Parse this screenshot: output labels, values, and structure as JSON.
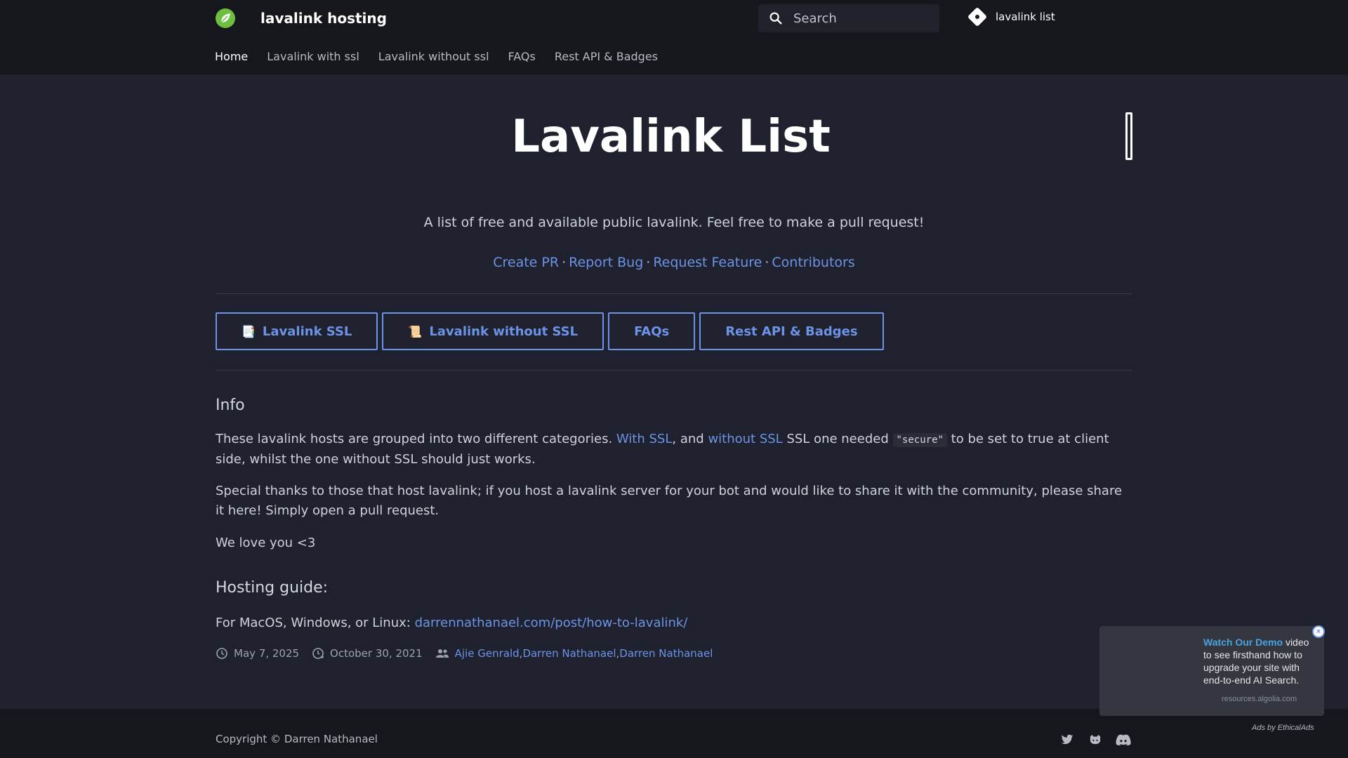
{
  "header": {
    "site_title": "lavalink hosting",
    "search_placeholder": "Search",
    "repo_label": "lavalink list"
  },
  "tabs": [
    {
      "label": "Home",
      "active": true
    },
    {
      "label": "Lavalink with ssl"
    },
    {
      "label": "Lavalink without ssl"
    },
    {
      "label": "FAQs"
    },
    {
      "label": "Rest API & Badges"
    }
  ],
  "main": {
    "title": "Lavalink List",
    "tagline": "A list of free and available public lavalink. Feel free to make a pull request!",
    "links": [
      "Create PR",
      "Report Bug",
      "Request Feature",
      "Contributors"
    ],
    "link_separator": "·",
    "buttons": [
      {
        "emoji": "📑",
        "label": "Lavalink SSL"
      },
      {
        "emoji": "📜",
        "label": "Lavalink without SSL"
      },
      {
        "emoji": "",
        "label": "FAQs"
      },
      {
        "emoji": "",
        "label": "Rest API & Badges"
      }
    ],
    "info_heading": "Info",
    "info_p1_a": "These lavalink hosts are grouped into two different categories.",
    "info_p1_link1": "With SSL",
    "info_p1_b": ", and",
    "info_p1_link2": "without SSL",
    "info_p1_c": "SSL one needed",
    "info_p1_code": "\"secure\"",
    "info_p1_d": "to be set to true at client side, whilst the one without SSL should just works.",
    "info_p2": "Special thanks to those that host lavalink; if you host a lavalink server for your bot and would like to share it with the community, please share it here! Simply open a pull request.",
    "info_p3": "We love you <3",
    "guide_heading": "Hosting guide:",
    "guide_text": "For MacOS, Windows, or Linux:",
    "guide_link": "darrennathanael.com/post/how-to-lavalink/",
    "updated_date": "May 7, 2025",
    "created_date": "October 30, 2021",
    "contributors": [
      "Ajie Genrald",
      "Darren Nathanael",
      "Darren Nathanael"
    ]
  },
  "footer": {
    "copyright": "Copyright © Darren Nathanael",
    "social_icons": [
      "twitter-icon",
      "github-icon",
      "discord-icon"
    ]
  },
  "ad": {
    "highlight": "Watch Our Demo",
    "text": "video to see firsthand how to upgrade your site with end-to-end AI Search.",
    "domain": "resources.algolia.com",
    "by": "Ads by EthicalAds",
    "close": "×"
  },
  "colors": {
    "accent": "#6c93e6",
    "background": "#1f222e",
    "header_bg": "#16171d"
  }
}
